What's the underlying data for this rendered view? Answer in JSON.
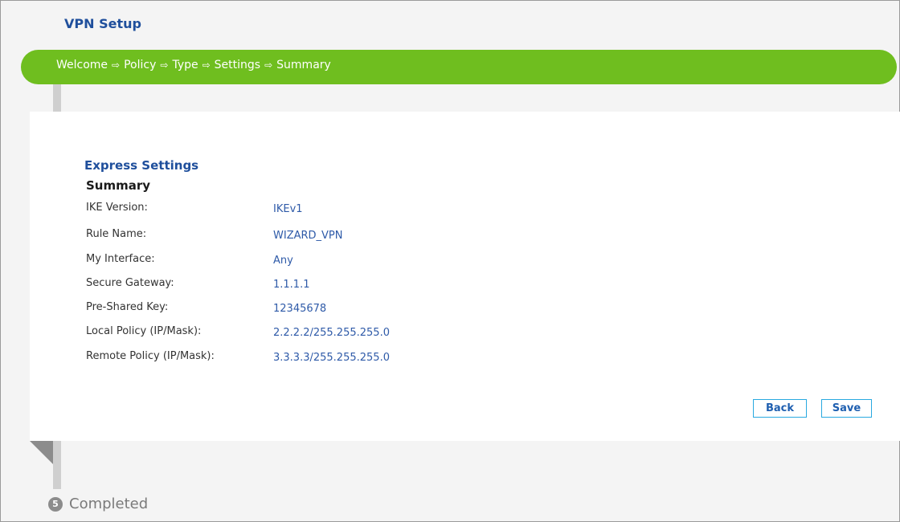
{
  "header": {
    "title": "VPN Setup"
  },
  "wizard": {
    "steps": [
      "Welcome",
      "Policy",
      "Type",
      "Settings",
      "Summary"
    ],
    "arrow": "⇨",
    "completed_number": "5",
    "completed_label": "Completed"
  },
  "panel": {
    "section_title": "Express Settings",
    "subtitle": "Summary",
    "rows": [
      {
        "label": "IKE Version:",
        "value": "IKEv1"
      },
      {
        "label": "Rule Name:",
        "value": "WIZARD_VPN"
      },
      {
        "label": "My Interface:",
        "value": "Any"
      },
      {
        "label": "Secure Gateway:",
        "value": "1.1.1.1"
      },
      {
        "label": "Pre-Shared Key:",
        "value": "12345678"
      },
      {
        "label": "Local Policy (IP/Mask):",
        "value": "2.2.2.2/255.255.255.0"
      },
      {
        "label": "Remote Policy (IP/Mask):",
        "value": "3.3.3.3/255.255.255.0"
      }
    ]
  },
  "buttons": {
    "back": "Back",
    "save": "Save"
  },
  "colors": {
    "progress_bar": "#6fbe1f",
    "title_blue": "#1f4f9c",
    "value_blue": "#2e5aa8",
    "button_border": "#29a9e0"
  }
}
